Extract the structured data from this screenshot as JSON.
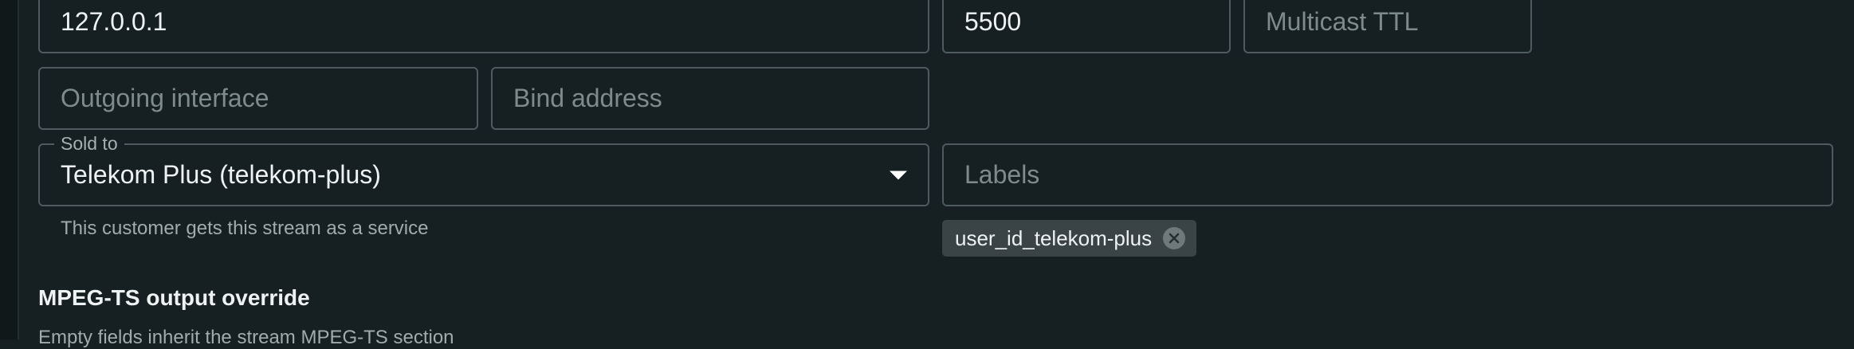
{
  "row1": {
    "address_value": "127.0.0.1",
    "port_value": "5500",
    "ttl_placeholder": "Multicast TTL"
  },
  "row2": {
    "outgoing_placeholder": "Outgoing interface",
    "bind_placeholder": "Bind address"
  },
  "sold_to": {
    "legend": "Sold to",
    "value": "Telekom Plus (telekom-plus)",
    "helper": "This customer gets this stream as a service"
  },
  "labels": {
    "placeholder": "Labels",
    "chips": [
      "user_id_telekom-plus"
    ]
  },
  "mpegts": {
    "title": "MPEG-TS output override",
    "subtitle": "Empty fields inherit the stream MPEG-TS section"
  },
  "icons": {
    "caret": "caret-down-icon",
    "chip_remove": "close-circle-icon"
  }
}
